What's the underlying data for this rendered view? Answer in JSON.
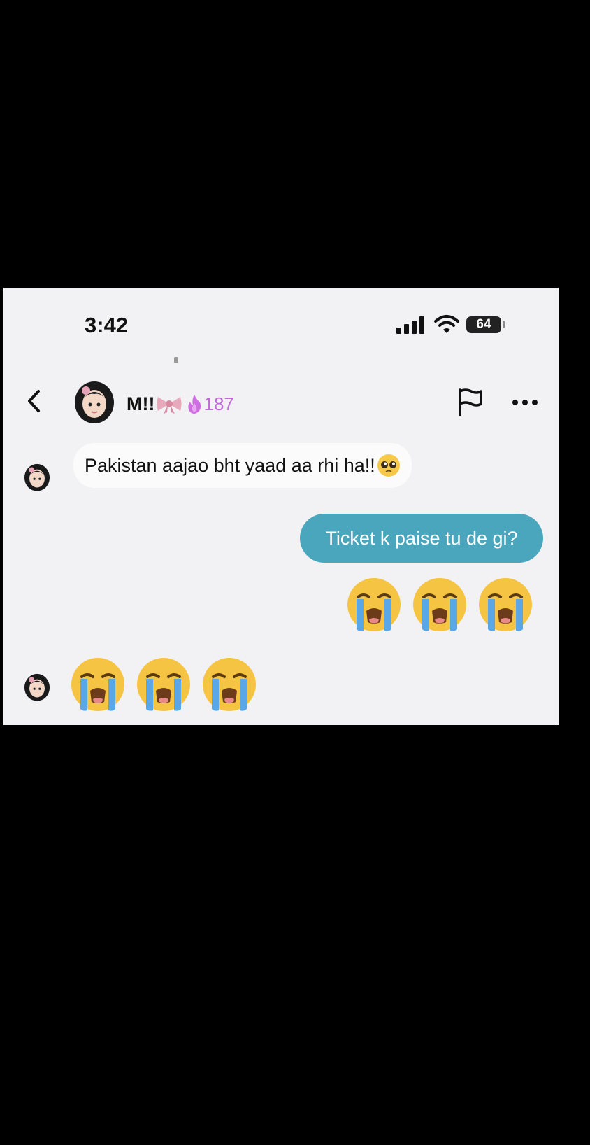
{
  "status_bar": {
    "time": "3:42",
    "battery": "64"
  },
  "header": {
    "contact_name": "M!!",
    "streak": "187"
  },
  "messages": [
    {
      "from": "contact",
      "text": "Pakistan aajao bht yaad aa rhi ha!!",
      "emoji": "pleading-face"
    },
    {
      "from": "me",
      "text": "Ticket k paise tu de gi?"
    },
    {
      "from": "me",
      "emojis": [
        "loudly-crying-face",
        "loudly-crying-face",
        "loudly-crying-face"
      ]
    },
    {
      "from": "contact",
      "emojis": [
        "loudly-crying-face",
        "loudly-crying-face",
        "loudly-crying-face"
      ]
    }
  ],
  "colors": {
    "outgoing_bubble": "#49a6bd",
    "streak": "#c06ad8",
    "background": "#f2f2f4"
  }
}
